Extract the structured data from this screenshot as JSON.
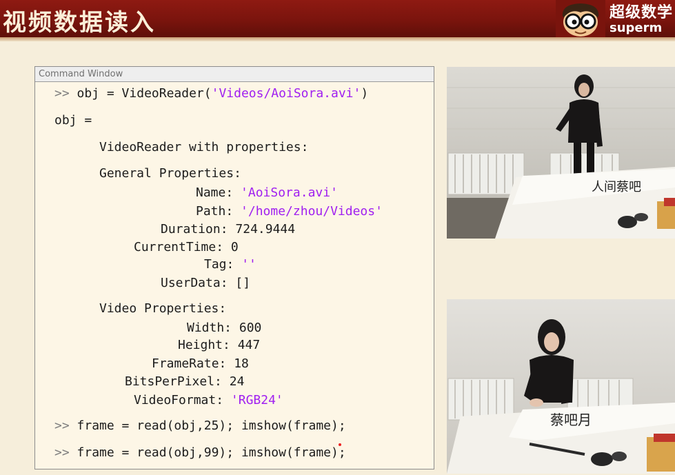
{
  "header": {
    "title": "视频数据读入",
    "logo_cn": "超级数学",
    "logo_en": "superm"
  },
  "command_window": {
    "title": "Command Window",
    "lines": {
      "cmd1": {
        "prompt": ">>",
        "code": "obj = VideoReader(",
        "str": "'Videos/AoiSora.avi'",
        "end": ")"
      },
      "obj_eq": "obj =",
      "heading": "VideoReader with properties:",
      "general": "General Properties:",
      "name_key": "Name:",
      "name_val": "'AoiSora.avi'",
      "path_key": "Path:",
      "path_val": "'/home/zhou/Videos'",
      "duration_key": "Duration:",
      "duration_val": "724.9444",
      "currenttime_key": "CurrentTime:",
      "currenttime_val": "0",
      "tag_key": "Tag:",
      "tag_val": "''",
      "userdata_key": "UserData:",
      "userdata_val": "[]",
      "video": "Video Properties:",
      "width_key": "Width:",
      "width_val": "600",
      "height_key": "Height:",
      "height_val": "447",
      "framerate_key": "FrameRate:",
      "framerate_val": "18",
      "bpp_key": "BitsPerPixel:",
      "bpp_val": "24",
      "format_key": "VideoFormat:",
      "format_val": "'RGB24'",
      "cmd2": {
        "prompt": ">>",
        "code": "frame = read(obj,25); imshow(frame);"
      },
      "cmd3": {
        "prompt": ">>",
        "code": "frame = read(obj,99); imshow(frame);"
      }
    }
  },
  "photos": {
    "frame1_calligraphy": "人间蔡吧",
    "frame2_calligraphy": "蔡吧月"
  },
  "colors": {
    "banner": "#7a140d",
    "background": "#f6eedb",
    "string_literal": "#a020f0",
    "prompt": "#7e7e7e"
  }
}
